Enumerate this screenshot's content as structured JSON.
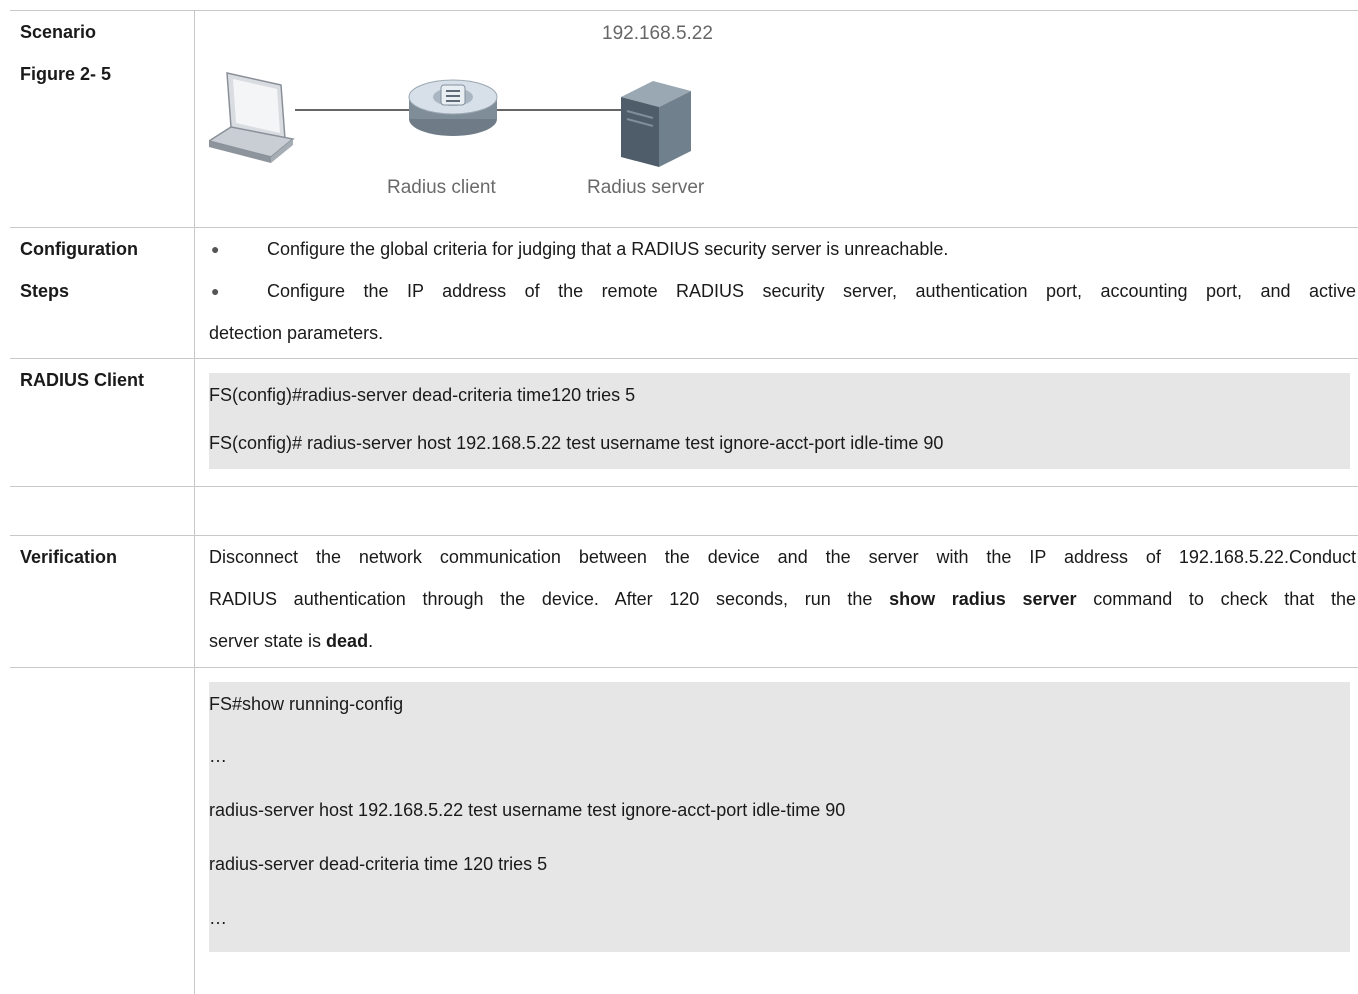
{
  "rows": {
    "scenario": {
      "label_line1": "Scenario",
      "label_line2": "Figure 2- 5",
      "diagram": {
        "server_ip": "192.168.5.22",
        "client_label": "Radius client",
        "server_label": "Radius server",
        "laptop_icon": "laptop-icon",
        "switch_icon": "switch-icon",
        "server_icon": "server-icon"
      }
    },
    "config": {
      "label_line1": "Configuration",
      "label_line2": "Steps",
      "bullets": [
        "Configure the global criteria for judging that a RADIUS security server is unreachable.",
        "Configure the IP address of the remote RADIUS security server, authentication port, accounting port, and active"
      ],
      "bullet2_continuation": "detection parameters."
    },
    "client": {
      "label": "RADIUS Client",
      "code": [
        "FS(config)#radius-server dead-criteria time120 tries 5",
        "FS(config)# radius-server host 192.168.5.22 test username test ignore-acct-port idle-time 90"
      ]
    },
    "verify": {
      "label": "Verification",
      "text_line1": "Disconnect the network communication between the device and the server with the IP address of 192.168.5.22.Conduct",
      "text_line2_pre": "RADIUS authentication through the device. After 120 seconds, run the ",
      "text_line2_bold": "show radius server",
      "text_line2_post": " command to check that the",
      "text_line3_pre": "server state is ",
      "text_line3_bold": "dead",
      "text_line3_post": "."
    },
    "output": {
      "code": [
        "FS#show running-config",
        "…",
        "radius-server host 192.168.5.22 test username test ignore-acct-port idle-time 90",
        "radius-server dead-criteria time 120 tries 5",
        "…"
      ]
    }
  },
  "colors": {
    "border": "#c8c8c8",
    "code_bg": "#e6e6e6",
    "text": "#1a1a1a",
    "diagram_label": "#6a6a6a"
  }
}
